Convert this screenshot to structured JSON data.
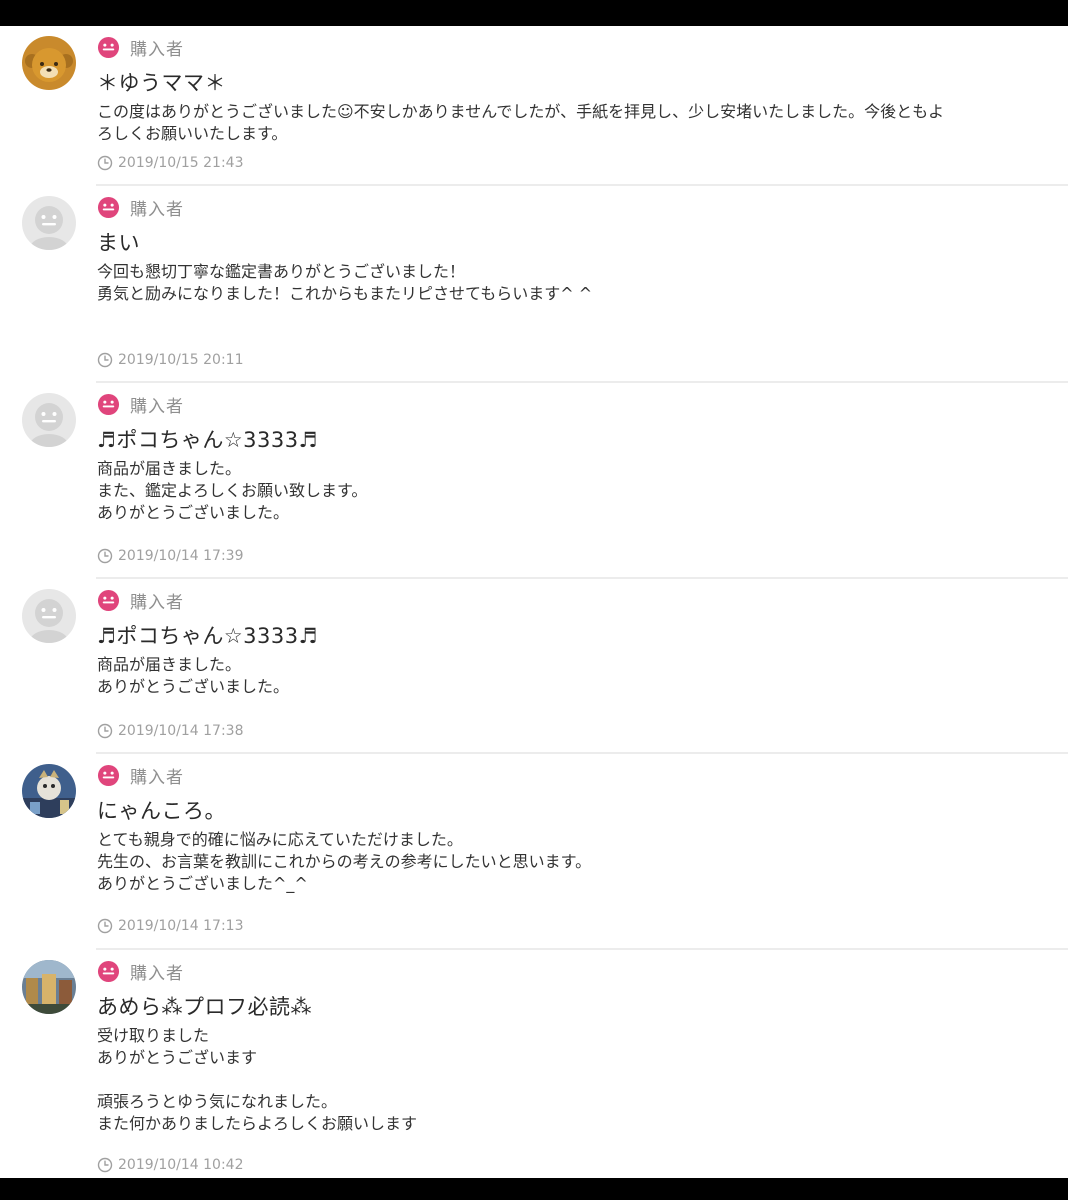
{
  "colors": {
    "frame": "#000000",
    "background": "#ffffff",
    "role_icon": "#e0457c",
    "role_label": "#8f8f8f",
    "username": "#2a2a2a",
    "comment": "#333333",
    "timestamp": "#a0a0a0",
    "divider": "#ececec"
  },
  "reviews": [
    {
      "avatar": "bear-avatar",
      "role": "購入者",
      "username": "＊ゆうママ＊",
      "lines": [
        "この度はありがとうございました☺不安しかありませんでしたが、手紙を拝見し、少し安堵いたしました。今後ともよ",
        "ろしくお願いいたします。"
      ],
      "timestamp": "2019/10/15 21:43"
    },
    {
      "avatar": "default-avatar",
      "role": "購入者",
      "username": "まい",
      "lines": [
        "今回も懇切丁寧な鑑定書ありがとうございました！",
        "勇気と励みになりました！これからもまたリピさせてもらいます^ ^"
      ],
      "timestamp": "2019/10/15 20:11"
    },
    {
      "avatar": "default-avatar",
      "role": "購入者",
      "username": "♬ポコちゃん☆3333♬",
      "lines": [
        "商品が届きました。",
        "また、鑑定よろしくお願い致します。",
        "ありがとうございました。"
      ],
      "timestamp": "2019/10/14 17:39"
    },
    {
      "avatar": "default-avatar",
      "role": "購入者",
      "username": "♬ポコちゃん☆3333♬",
      "lines": [
        "商品が届きました。",
        "ありがとうございました。"
      ],
      "timestamp": "2019/10/14 17:38"
    },
    {
      "avatar": "photo-avatar",
      "role": "購入者",
      "username": "にゃんころ。",
      "lines": [
        "とても親身で的確に悩みに応えていただけました。",
        "先生の、お言葉を教訓にこれからの考えの参考にしたいと思います。",
        "ありがとうございました^_^"
      ],
      "timestamp": "2019/10/14 17:13"
    },
    {
      "avatar": "photo-avatar",
      "role": "購入者",
      "username": "あめら⁂プロフ必読⁂",
      "lines": [
        "受け取りました",
        "ありがとうございます",
        "",
        "頑張ろうとゆう気になれました。",
        "また何かありましたらよろしくお願いします"
      ],
      "timestamp": "2019/10/14 10:42"
    }
  ]
}
